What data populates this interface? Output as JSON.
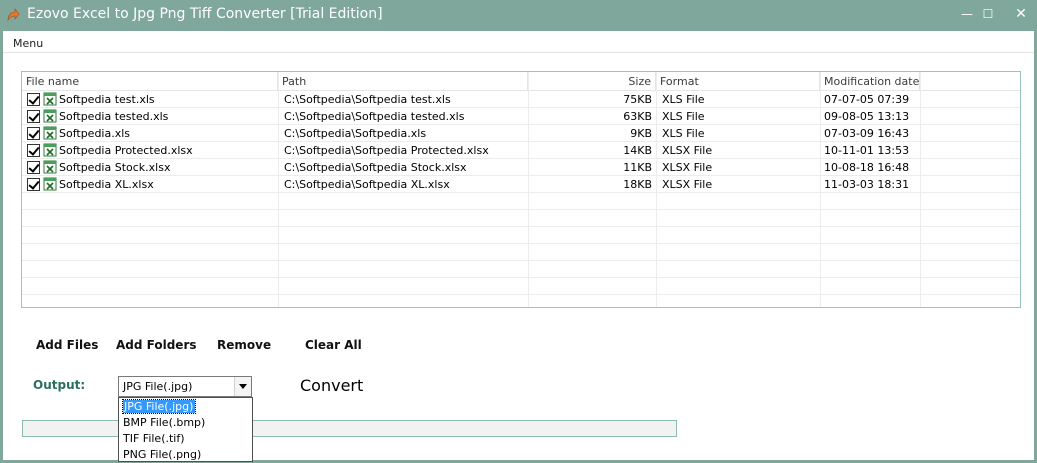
{
  "window": {
    "title": "Ezovo Excel to Jpg Png Tiff Converter [Trial Edition]",
    "controls": {
      "minimize": "—",
      "maximize": "☐",
      "close": "✕"
    }
  },
  "menubar": {
    "menu_label": "Menu"
  },
  "file_list": {
    "columns": [
      "File name",
      "Path",
      "Size",
      "Format",
      "Modification date"
    ],
    "rows": [
      {
        "checked": true,
        "name": "Softpedia test.xls",
        "path": "C:\\Softpedia\\Softpedia test.xls",
        "size": "75KB",
        "format": "XLS File",
        "modified": "07-07-05 07:39"
      },
      {
        "checked": true,
        "name": "Softpedia tested.xls",
        "path": "C:\\Softpedia\\Softpedia tested.xls",
        "size": "63KB",
        "format": "XLS File",
        "modified": "09-08-05 13:13"
      },
      {
        "checked": true,
        "name": "Softpedia.xls",
        "path": "C:\\Softpedia\\Softpedia.xls",
        "size": "9KB",
        "format": "XLS File",
        "modified": "07-03-09 16:43"
      },
      {
        "checked": true,
        "name": "Softpedia Protected.xlsx",
        "path": "C:\\Softpedia\\Softpedia Protected.xlsx",
        "size": "14KB",
        "format": "XLSX File",
        "modified": "10-11-01 13:53"
      },
      {
        "checked": true,
        "name": "Softpedia Stock.xlsx",
        "path": "C:\\Softpedia\\Softpedia Stock.xlsx",
        "size": "11KB",
        "format": "XLSX File",
        "modified": "10-08-18 16:48"
      },
      {
        "checked": true,
        "name": "Softpedia XL.xlsx",
        "path": "C:\\Softpedia\\Softpedia XL.xlsx",
        "size": "18KB",
        "format": "XLSX File",
        "modified": "11-03-03 18:31"
      }
    ]
  },
  "actions": {
    "add_files": "Add Files",
    "add_folders": "Add Folders",
    "remove": "Remove",
    "clear_all": "Clear All"
  },
  "output": {
    "label": "Output:",
    "selected": "JPG File(.jpg)",
    "options": [
      "JPG File(.jpg)",
      "BMP File(.bmp)",
      "TIF File(.tif)",
      "PNG File(.png)"
    ],
    "highlighted_index": 0
  },
  "convert_label": "Convert",
  "progress": {
    "fraction": 0
  },
  "colors": {
    "titlebar": "#7fa79c",
    "accent_green": "#2c6e5e",
    "selection_blue": "#3399ff",
    "list_border": "#9ac5b9"
  }
}
